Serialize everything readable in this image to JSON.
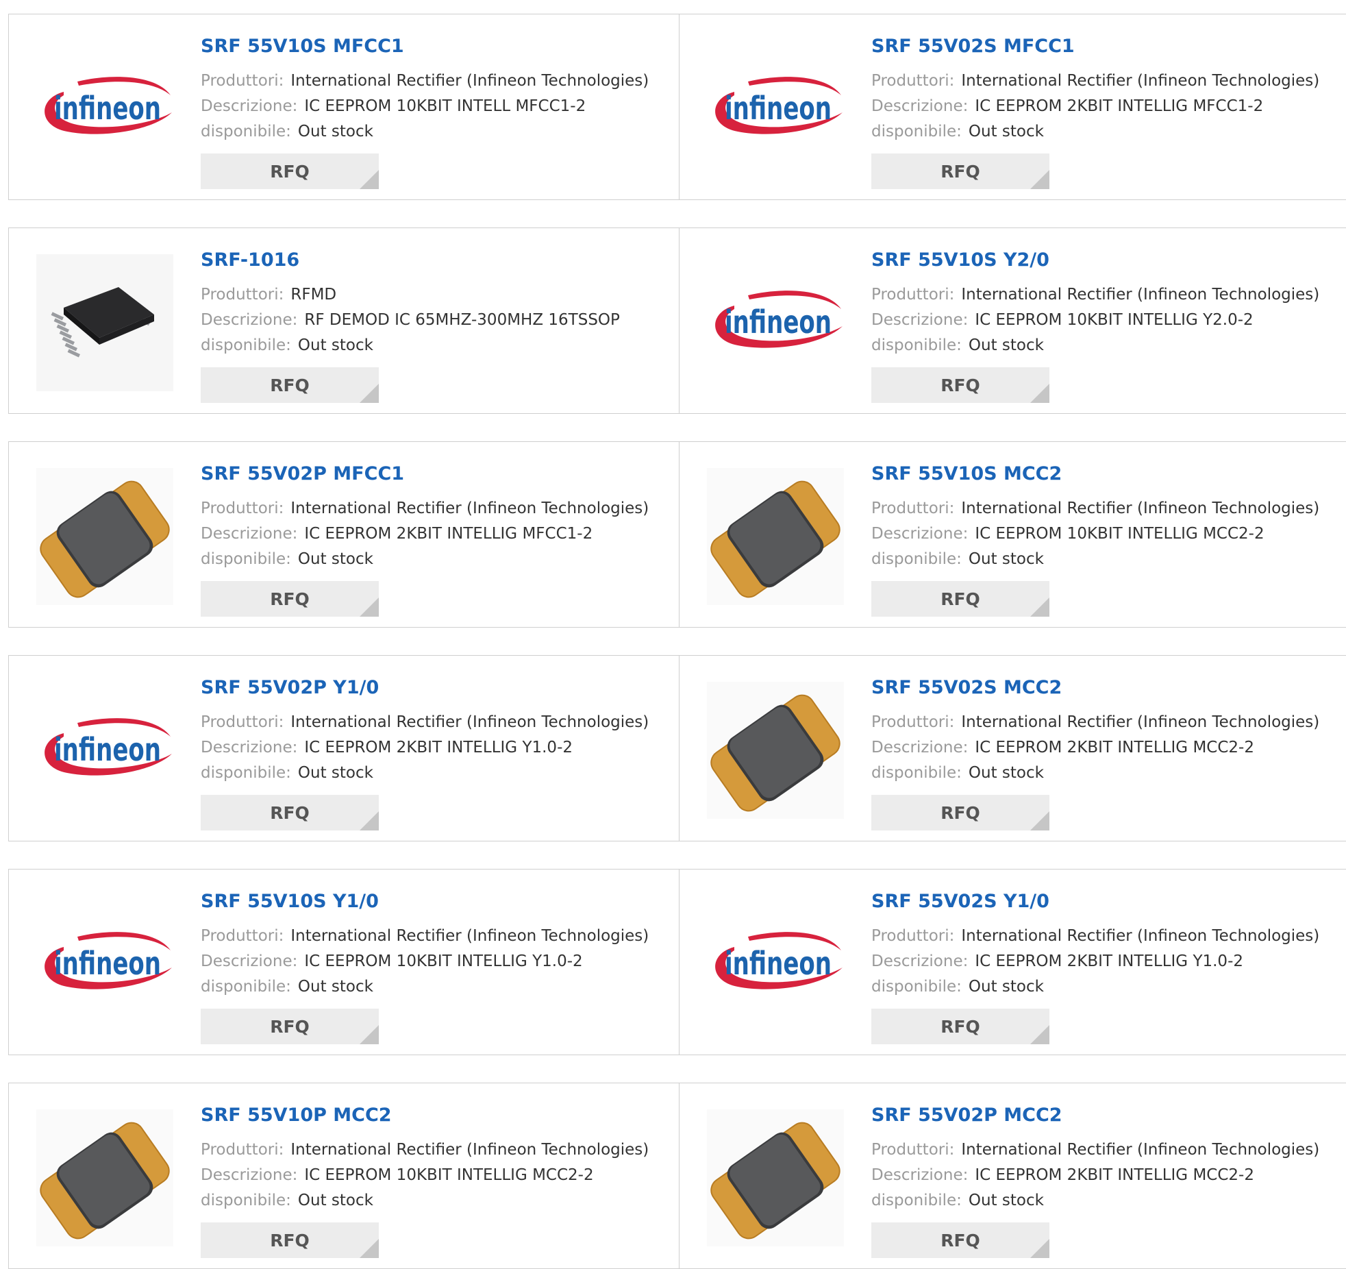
{
  "labels": {
    "manufacturer": "Produttori:",
    "description": "Descrizione:",
    "availability": "disponibile:",
    "rfq": "RFQ"
  },
  "logo_text": "infineon",
  "colors": {
    "title": "#1b64b7",
    "infineon_swoosh": "#d7223d",
    "infineon_text": "#1c63ad",
    "chip_body": "#58595b",
    "chip_tape": "#d59a3b"
  },
  "products": [
    {
      "part": "SRF 55V10S MFCC1",
      "manufacturer": "International Rectifier (Infineon Technologies)",
      "description": "IC EEPROM 10KBIT INTELL MFCC1-2",
      "availability": "Out stock",
      "image": "infineon-logo"
    },
    {
      "part": "SRF 55V02S MFCC1",
      "manufacturer": "International Rectifier (Infineon Technologies)",
      "description": "IC EEPROM 2KBIT INTELLIG MFCC1-2",
      "availability": "Out stock",
      "image": "infineon-logo"
    },
    {
      "part": "SRF-1016",
      "manufacturer": "RFMD",
      "description": "RF DEMOD IC 65MHZ-300MHZ 16TSSOP",
      "availability": "Out stock",
      "image": "tssop-chip"
    },
    {
      "part": "SRF 55V10S Y2/0",
      "manufacturer": "International Rectifier (Infineon Technologies)",
      "description": "IC EEPROM 10KBIT INTELLIG Y2.0-2",
      "availability": "Out stock",
      "image": "infineon-logo"
    },
    {
      "part": "SRF 55V02P MFCC1",
      "manufacturer": "International Rectifier (Infineon Technologies)",
      "description": "IC EEPROM 2KBIT INTELLIG MFCC1-2",
      "availability": "Out stock",
      "image": "module-chip"
    },
    {
      "part": "SRF 55V10S MCC2",
      "manufacturer": "International Rectifier (Infineon Technologies)",
      "description": "IC EEPROM 10KBIT INTELLIG MCC2-2",
      "availability": "Out stock",
      "image": "module-chip"
    },
    {
      "part": "SRF 55V02P Y1/0",
      "manufacturer": "International Rectifier (Infineon Technologies)",
      "description": "IC EEPROM 2KBIT INTELLIG Y1.0-2",
      "availability": "Out stock",
      "image": "infineon-logo"
    },
    {
      "part": "SRF 55V02S MCC2",
      "manufacturer": "International Rectifier (Infineon Technologies)",
      "description": "IC EEPROM 2KBIT INTELLIG MCC2-2",
      "availability": "Out stock",
      "image": "module-chip"
    },
    {
      "part": "SRF 55V10S Y1/0",
      "manufacturer": "International Rectifier (Infineon Technologies)",
      "description": "IC EEPROM 10KBIT INTELLIG Y1.0-2",
      "availability": "Out stock",
      "image": "infineon-logo"
    },
    {
      "part": "SRF 55V02S Y1/0",
      "manufacturer": "International Rectifier (Infineon Technologies)",
      "description": "IC EEPROM 2KBIT INTELLIG Y1.0-2",
      "availability": "Out stock",
      "image": "infineon-logo"
    },
    {
      "part": "SRF 55V10P MCC2",
      "manufacturer": "International Rectifier (Infineon Technologies)",
      "description": "IC EEPROM 10KBIT INTELLIG MCC2-2",
      "availability": "Out stock",
      "image": "module-chip"
    },
    {
      "part": "SRF 55V02P MCC2",
      "manufacturer": "International Rectifier (Infineon Technologies)",
      "description": "IC EEPROM 2KBIT INTELLIG MCC2-2",
      "availability": "Out stock",
      "image": "module-chip"
    }
  ]
}
